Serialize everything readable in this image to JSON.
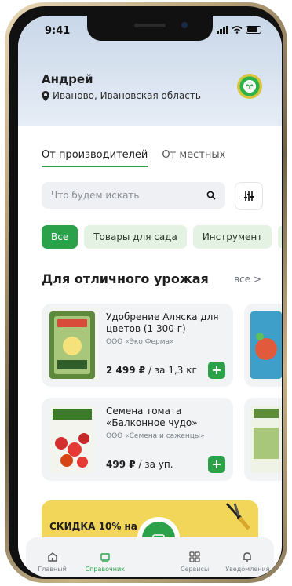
{
  "status_bar": {
    "time": "9:41"
  },
  "user": {
    "name": "Андрей",
    "location": "Иваново, Ивановская область"
  },
  "tabs": [
    {
      "label": "От производителей",
      "active": true
    },
    {
      "label": "От местных",
      "active": false
    }
  ],
  "search": {
    "placeholder": "Что будем искать"
  },
  "chips": [
    {
      "label": "Все",
      "active": true
    },
    {
      "label": "Товары для сада",
      "active": false
    },
    {
      "label": "Инструмент",
      "active": false
    }
  ],
  "section": {
    "title": "Для отличного урожая",
    "see_all": "все >"
  },
  "products": [
    {
      "title": "Удобрение Аляска для цветов (1 300 г)",
      "vendor": "ООО «Эко Ферма»",
      "price": "2 499 ₽",
      "unit": "/ за 1,3 кг"
    },
    {
      "title": "Семена томата «Балконное чудо»",
      "vendor": "ООО «Семена и саженцы»",
      "price": "499 ₽",
      "unit": "/ за уп."
    }
  ],
  "banner": {
    "text": "СКИДКА 10% на"
  },
  "nav": [
    {
      "label": "Главный",
      "icon": "home-icon",
      "active": false
    },
    {
      "label": "Справочник",
      "icon": "directory-icon",
      "active": true
    },
    {
      "label": "Сервисы",
      "icon": "grid-icon",
      "active": false
    },
    {
      "label": "Уведомления",
      "icon": "bell-icon",
      "active": false
    }
  ],
  "colors": {
    "accent": "#2ba14a",
    "header": "#c9d7e8",
    "banner": "#f1d65a"
  }
}
